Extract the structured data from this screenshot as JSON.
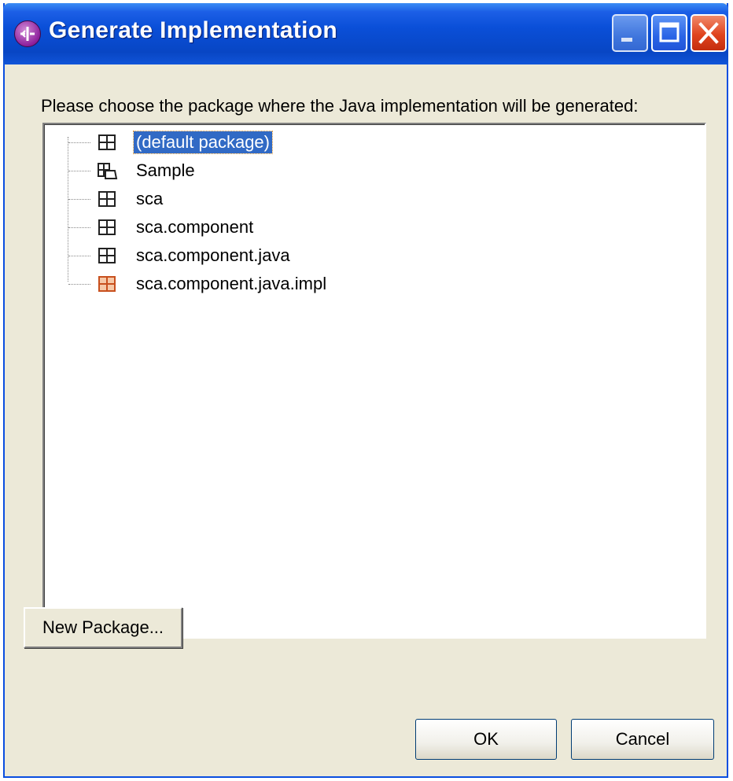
{
  "window": {
    "title": "Generate Implementation",
    "title_icon": "purple-component-icon",
    "controls": [
      "minimize-icon",
      "maximize-icon",
      "close-icon"
    ]
  },
  "prompt": "Please choose the package where the Java implementation will be generated:",
  "packages": [
    {
      "label": "(default package)",
      "icon": "package-icon",
      "selected": true
    },
    {
      "label": "Sample",
      "icon": "package-folder-icon",
      "selected": false
    },
    {
      "label": "sca",
      "icon": "package-icon",
      "selected": false
    },
    {
      "label": "sca.component",
      "icon": "package-icon",
      "selected": false
    },
    {
      "label": "sca.component.java",
      "icon": "package-icon",
      "selected": false
    },
    {
      "label": "sca.component.java.impl",
      "icon": "package-highlight-icon",
      "selected": false
    }
  ],
  "buttons": {
    "new_package": "New Package...",
    "ok": "OK",
    "cancel": "Cancel"
  },
  "colors": {
    "titlebar": "#0a4fd8",
    "selection": "#316ac5",
    "dialog_bg": "#ece9d8",
    "close_button": "#e0441e",
    "highlight_package": "#d4572a"
  }
}
